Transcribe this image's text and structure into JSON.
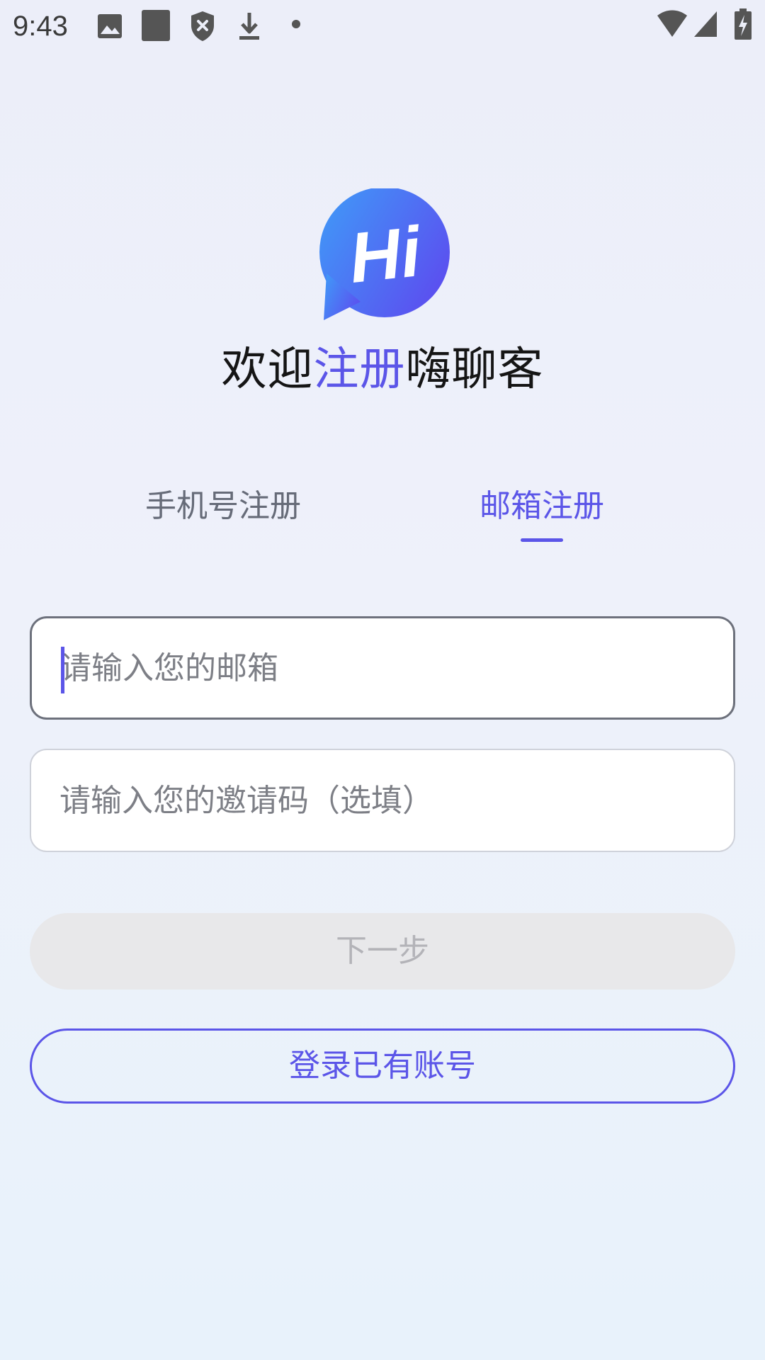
{
  "status_bar": {
    "time": "9:43",
    "icons": [
      "image-icon",
      "square-icon",
      "shield-icon",
      "download-icon",
      "dot-icon",
      "wifi-icon",
      "signal-icon",
      "battery-icon"
    ]
  },
  "header": {
    "logo_text": "Hi",
    "title_part1": "欢迎",
    "title_accent": "注册",
    "title_part2": "嗨聊客"
  },
  "tabs": [
    {
      "label": "手机号注册",
      "active": false
    },
    {
      "label": "邮箱注册",
      "active": true
    }
  ],
  "form": {
    "email_placeholder": "请输入您的邮箱",
    "invite_placeholder": "请输入您的邀请码（选填）"
  },
  "buttons": {
    "next_label": "下一步",
    "login_label": "登录已有账号"
  },
  "colors": {
    "accent": "#5b55e8",
    "logo_gradient_start": "#3f9cf8",
    "logo_gradient_end": "#5a52f0",
    "disabled_bg": "#e8e8ea",
    "disabled_text": "#b3b3b8"
  }
}
